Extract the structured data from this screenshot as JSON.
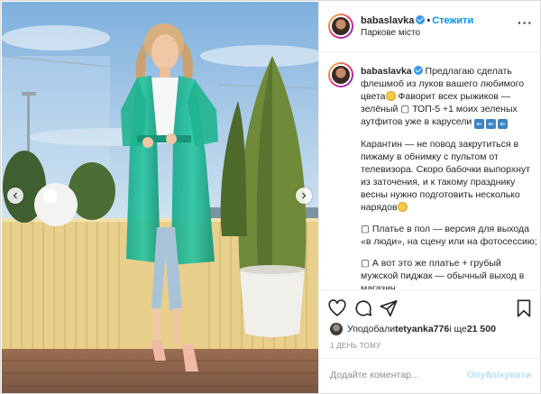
{
  "post": {
    "username": "babaslavka",
    "follow_label": "Стежити",
    "location": "Паркове місто",
    "more_icon": "more-dots-icon"
  },
  "caption": {
    "username": "babaslavka",
    "p1": "Предлагаю сделать флешмоб из луков вашего любимого цвета",
    "p1b": " Фаворит всех рыжиков — зелёный ▢ ТОП-5 +1 моих зеленых аутфитов уже в карусели ",
    "p2": "Карантин — не повод закрутиться в пижаму в обнимку с пультом от телевизора. Скоро бабочки выпорхнут из заточения, и к такому празднику весны нужно подготовить несколько нарядов",
    "p3": "▢ Платье в пол — версия для выхода «в люди», на сцену или на фотосессию;",
    "p4": "▢ А вот это же платье + грубый мужской пиджак — обычный выход в магазин"
  },
  "actions": {
    "like_icon": "heart-icon",
    "comment_icon": "comment-icon",
    "share_icon": "share-icon",
    "save_icon": "bookmark-icon"
  },
  "likes": {
    "prefix": "Уподобали ",
    "user": "tetyanka776",
    "middle": " і ще ",
    "count": "21 500"
  },
  "time_ago": "1 ДЕНЬ ТОМУ",
  "comment": {
    "placeholder": "Додайте коментар...",
    "post_label": "Опублікувати"
  },
  "colors": {
    "accent": "#0095f6",
    "verified": "#3897f0",
    "post_disabled": "#b2dffc"
  }
}
